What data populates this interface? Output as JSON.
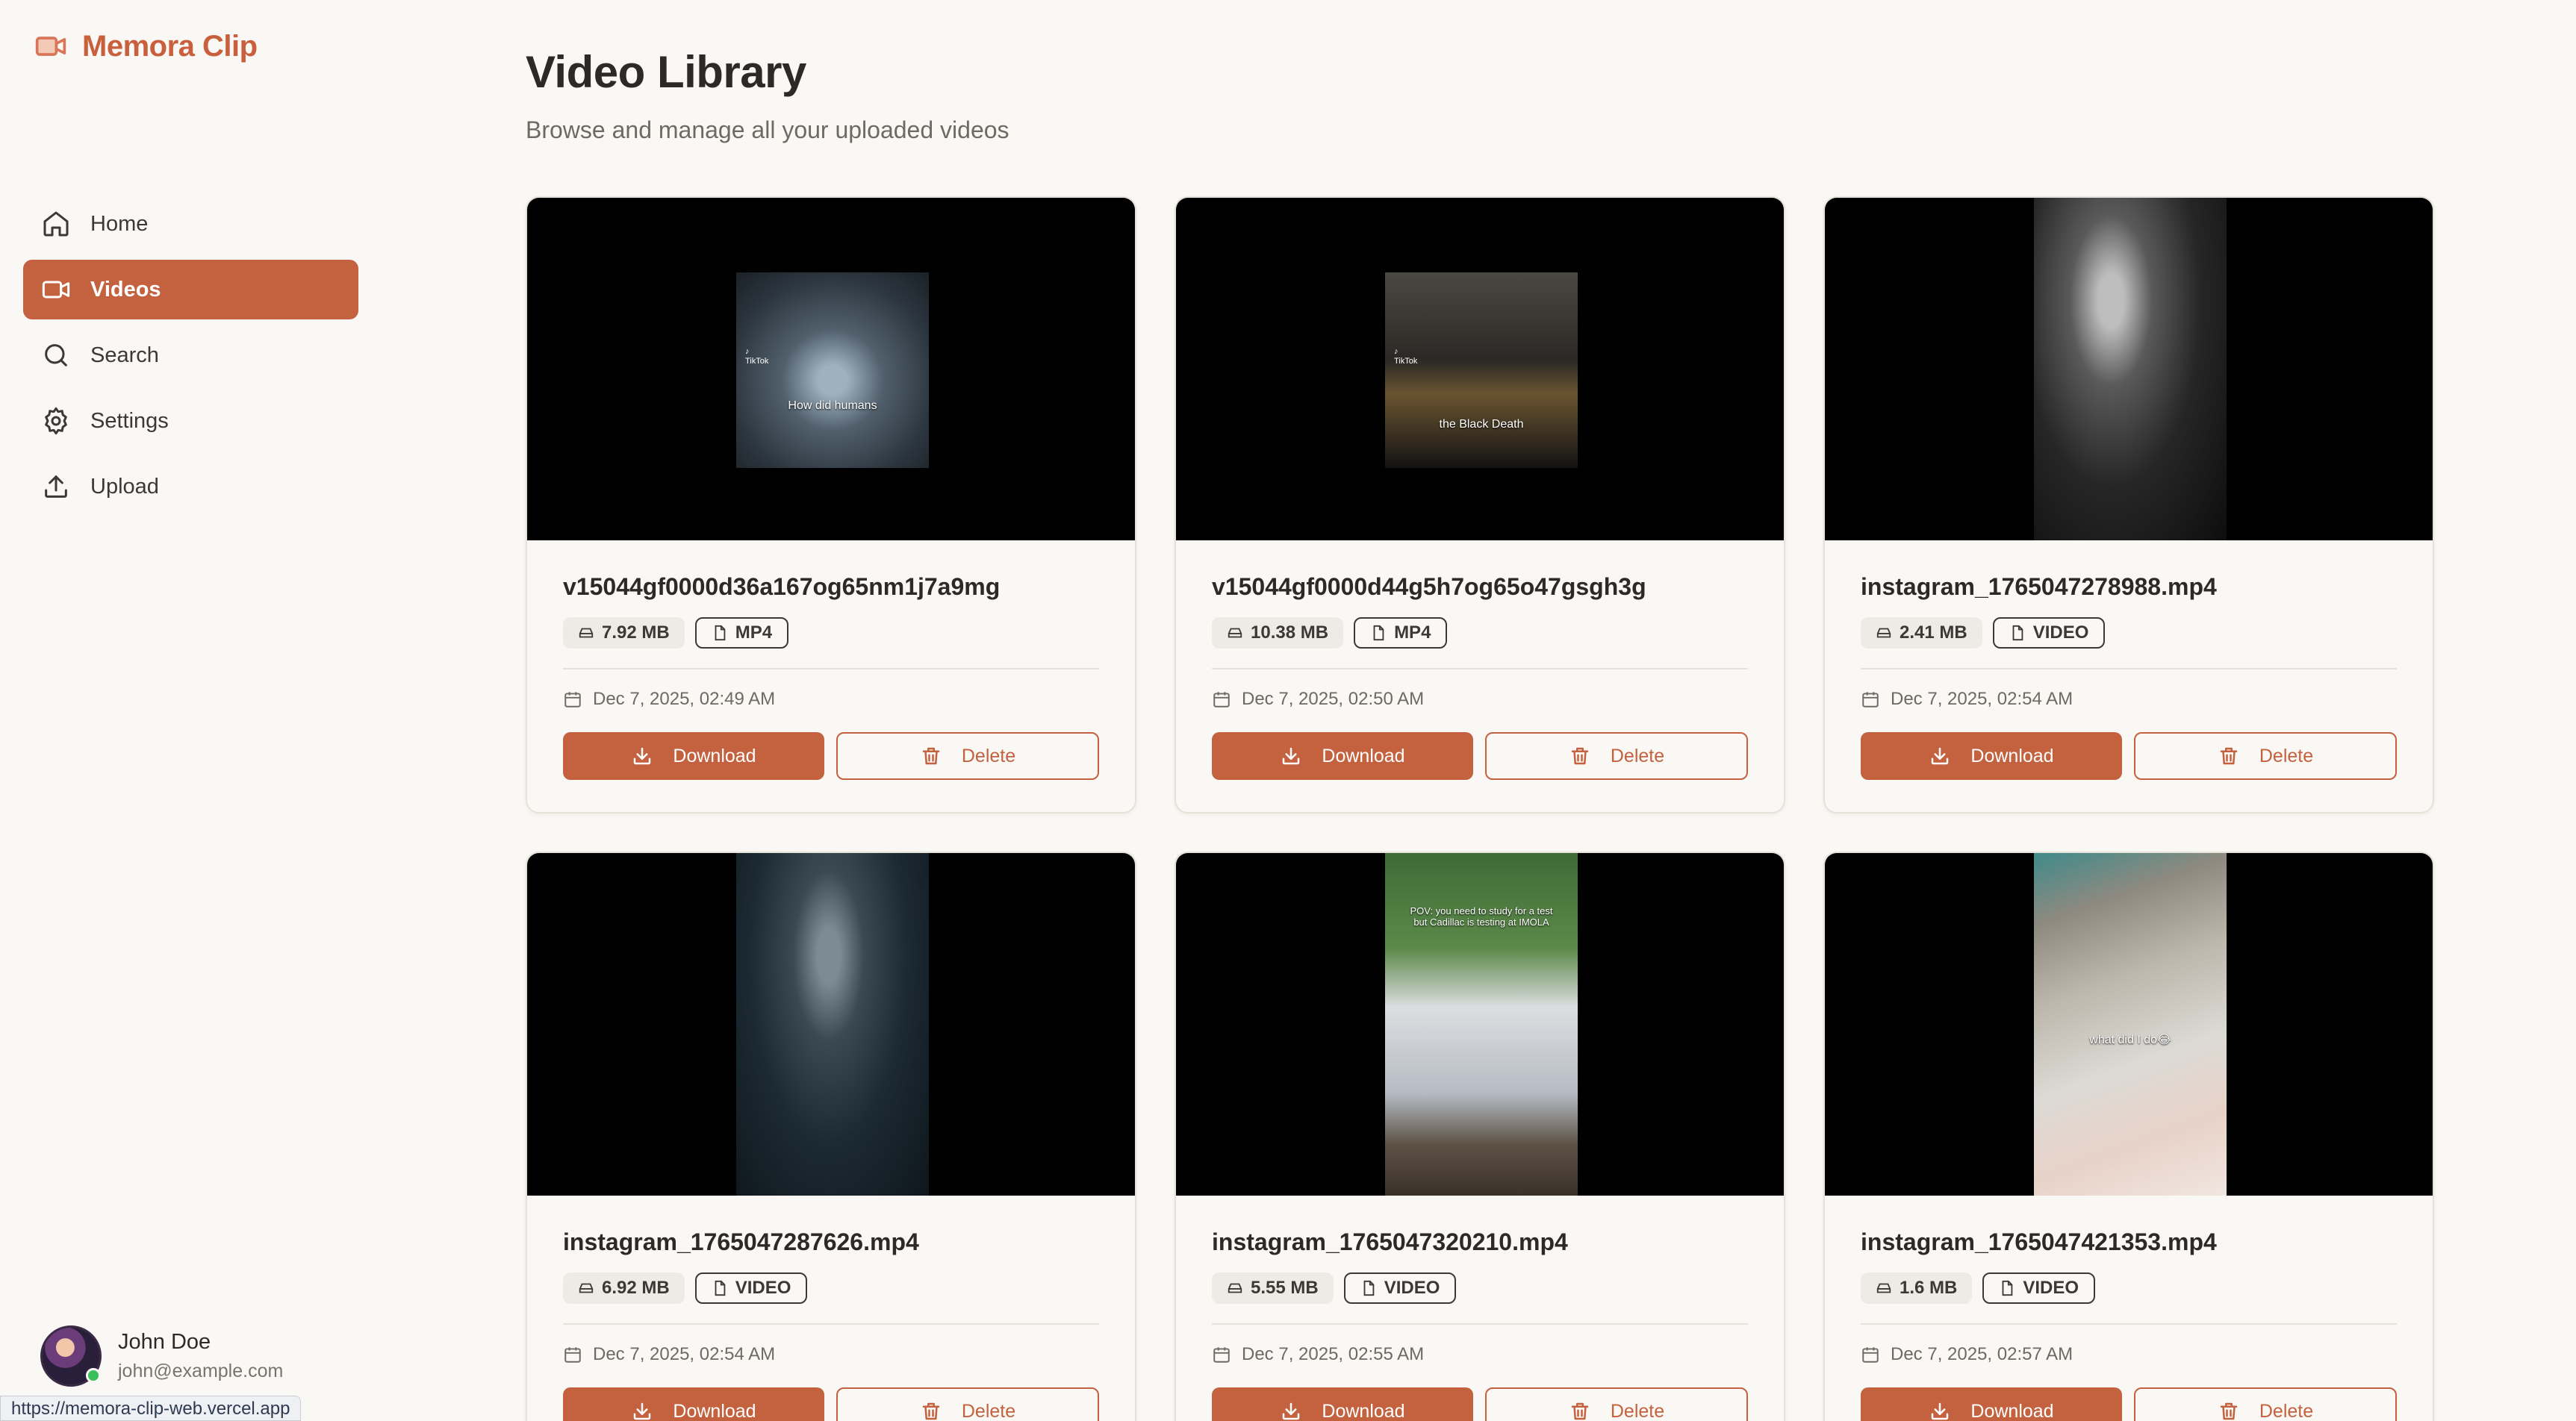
{
  "app": {
    "name": "Memora Clip"
  },
  "sidebar": {
    "items": [
      {
        "label": "Home",
        "icon": "home-icon",
        "active": false
      },
      {
        "label": "Videos",
        "icon": "video-icon",
        "active": true
      },
      {
        "label": "Search",
        "icon": "search-icon",
        "active": false
      },
      {
        "label": "Settings",
        "icon": "gear-icon",
        "active": false
      },
      {
        "label": "Upload",
        "icon": "upload-icon",
        "active": false
      }
    ]
  },
  "user": {
    "name": "John Doe",
    "email": "john@example.com"
  },
  "status_url": "https://memora-clip-web.vercel.app",
  "main": {
    "title": "Video Library",
    "subtitle": "Browse and manage all your uploaded videos",
    "download_label": "Download",
    "delete_label": "Delete"
  },
  "videos": [
    {
      "name": "v15044gf0000d36a167og65nm1j7a9mg",
      "size": "7.92 MB",
      "format": "MP4",
      "date": "Dec 7, 2025, 02:49 AM",
      "thumb_caption": "How did humans",
      "thumb_shape": "square"
    },
    {
      "name": "v15044gf0000d44g5h7og65o47gsgh3g",
      "size": "10.38 MB",
      "format": "MP4",
      "date": "Dec 7, 2025, 02:50 AM",
      "thumb_caption": "the Black Death",
      "thumb_shape": "square"
    },
    {
      "name": "instagram_1765047278988.mp4",
      "size": "2.41 MB",
      "format": "VIDEO",
      "date": "Dec 7, 2025, 02:54 AM",
      "thumb_caption": "",
      "thumb_shape": "tall"
    },
    {
      "name": "instagram_1765047287626.mp4",
      "size": "6.92 MB",
      "format": "VIDEO",
      "date": "Dec 7, 2025, 02:54 AM",
      "thumb_caption": "",
      "thumb_shape": "tall"
    },
    {
      "name": "instagram_1765047320210.mp4",
      "size": "5.55 MB",
      "format": "VIDEO",
      "date": "Dec 7, 2025, 02:55 AM",
      "thumb_caption": "POV: you need to study for a test but Cadillac is testing at IMOLA",
      "thumb_shape": "tall"
    },
    {
      "name": "instagram_1765047421353.mp4",
      "size": "1.6 MB",
      "format": "VIDEO",
      "date": "Dec 7, 2025, 02:57 AM",
      "thumb_caption": "what did I do😂",
      "thumb_shape": "tall"
    }
  ],
  "colors": {
    "accent": "#c4613f",
    "background": "#faf8f4",
    "logo": "#c8603e"
  }
}
